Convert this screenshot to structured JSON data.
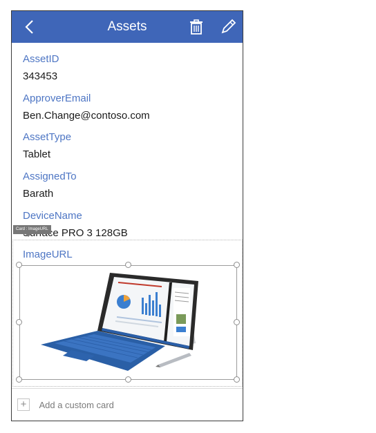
{
  "header": {
    "title": "Assets",
    "back_icon": "chevron-left-icon",
    "delete_icon": "trash-icon",
    "edit_icon": "pencil-icon",
    "bg_color": "#3f66b8"
  },
  "fields": [
    {
      "label": "AssetID",
      "value": "343453"
    },
    {
      "label": "ApproverEmail",
      "value": "Ben.Change@contoso.com"
    },
    {
      "label": "AssetType",
      "value": "Tablet"
    },
    {
      "label": "AssignedTo",
      "value": "Barath"
    },
    {
      "label": "DeviceName",
      "value": "Surface PRO 3 128GB"
    }
  ],
  "image_card": {
    "tooltip": "Card : ImageURL",
    "label": "ImageURL",
    "image_description_icon": "surface-tablet-image"
  },
  "footer": {
    "add_label": "Add a custom card",
    "add_icon": "plus-icon"
  },
  "colors": {
    "accent": "#3f66b8",
    "label": "#4e76c4"
  }
}
